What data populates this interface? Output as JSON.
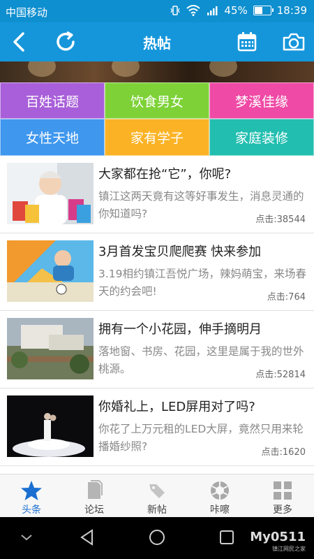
{
  "status_bar": {
    "carrier": "中国移动",
    "battery": "45%",
    "battery_level": 0.45,
    "time": "18:39"
  },
  "header": {
    "title": "热帖",
    "back_icon": "back-arrow-icon",
    "refresh_icon": "refresh-icon",
    "calendar_icon": "calendar-icon",
    "camera_icon": "camera-icon"
  },
  "categories": [
    {
      "label": "百姓话题",
      "color": "#a85fd9"
    },
    {
      "label": "饮食男女",
      "color": "#7ed238"
    },
    {
      "label": "梦溪佳缘",
      "color": "#ef4aa5"
    },
    {
      "label": "女性天地",
      "color": "#3f97ee"
    },
    {
      "label": "家有学子",
      "color": "#fbb325"
    },
    {
      "label": "家庭装修",
      "color": "#22beb0"
    }
  ],
  "posts": [
    {
      "title": "大家都在抢“它”，你呢?",
      "desc": "镇江这两天竟有这等好事发生，消息灵通的你知道吗?",
      "clicks": "点击:38544"
    },
    {
      "title": "3月首发宝贝爬爬赛 快来参加",
      "desc": "3.19相约镇江吾悦广场，辣妈萌宝，来场春天的约会吧!",
      "clicks": "点击:764"
    },
    {
      "title": "拥有一个小花园，伸手摘明月",
      "desc": "落地窗、书房、花园，这里是属于我的世外桃源。",
      "clicks": "点击:52814"
    },
    {
      "title": "你婚礼上，LED屏用对了吗?",
      "desc": "你花了上万元租的LED大屏，竟然只用来轮播婚纱照?",
      "clicks": "点击:1620"
    }
  ],
  "tabs": [
    {
      "label": "头条",
      "icon": "star-icon"
    },
    {
      "label": "论坛",
      "icon": "forum-icon"
    },
    {
      "label": "新帖",
      "icon": "tag-icon"
    },
    {
      "label": "咔嚓",
      "icon": "shutter-icon"
    },
    {
      "label": "更多",
      "icon": "grid-icon"
    }
  ],
  "watermark": {
    "brand": "My0511",
    "sub": "镇江网民之家"
  },
  "accent_color": "#1596db"
}
